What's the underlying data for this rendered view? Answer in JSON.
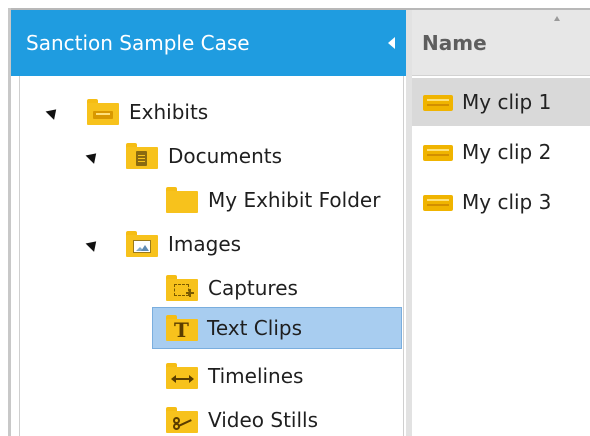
{
  "header": {
    "title": "Sanction Sample Case"
  },
  "tree": {
    "nodes": [
      {
        "label": "Exhibits",
        "icon": "exhibit-folder-icon",
        "expanded": true
      },
      {
        "label": "Documents",
        "icon": "document-folder-icon",
        "expanded": true
      },
      {
        "label": "My Exhibit Folder",
        "icon": "folder-icon"
      },
      {
        "label": "Images",
        "icon": "image-folder-icon",
        "expanded": true
      },
      {
        "label": "Captures",
        "icon": "capture-folder-icon"
      },
      {
        "label": "Text Clips",
        "icon": "text-clip-folder-icon",
        "selected": true
      },
      {
        "label": "Timelines",
        "icon": "timeline-folder-icon"
      },
      {
        "label": "Video Stills",
        "icon": "video-still-folder-icon"
      }
    ]
  },
  "list": {
    "column_header": "Name",
    "items": [
      {
        "label": "My clip 1",
        "selected": true
      },
      {
        "label": "My clip 2"
      },
      {
        "label": "My clip 3"
      }
    ]
  },
  "colors": {
    "header_blue": "#1f9ce0",
    "folder_yellow": "#f7c21c",
    "selected_row": "#a8cdf0",
    "list_selected": "#d9d9d9"
  }
}
